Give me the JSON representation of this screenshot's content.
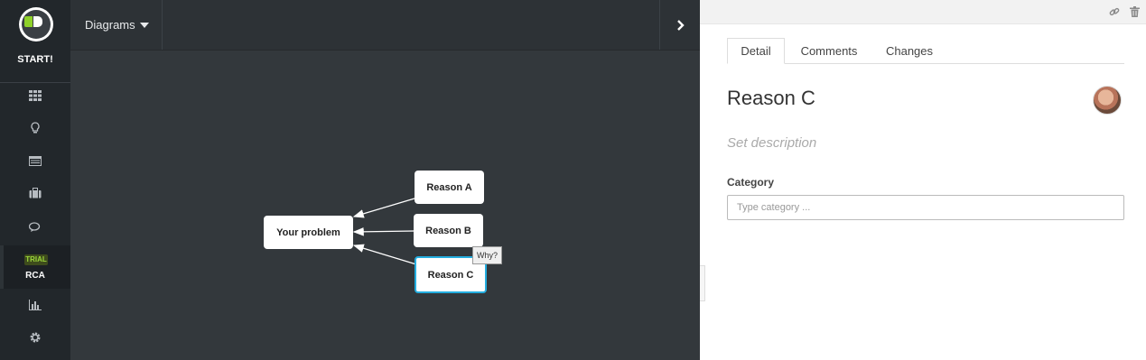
{
  "nav": {
    "start_label": "START!",
    "trial_badge": "TRIAL",
    "rca_label": "RCA",
    "icons": [
      "grid-icon",
      "lightbulb-icon",
      "list-icon",
      "briefcase-icon",
      "chat-icon",
      "chart-icon",
      "gear-icon"
    ]
  },
  "topbar": {
    "diagrams_label": "Diagrams",
    "expand_glyph": "›"
  },
  "diagram": {
    "problem": "Your problem",
    "reasons": [
      "Reason A",
      "Reason B",
      "Reason C"
    ],
    "tooltip": "Why?",
    "selection_color": "#24aee0"
  },
  "panel": {
    "tabs": [
      "Detail",
      "Comments",
      "Changes"
    ],
    "active_tab": "Detail",
    "title": "Reason C",
    "description_placeholder": "Set description",
    "category_label": "Category",
    "category_placeholder": "Type category ..."
  }
}
